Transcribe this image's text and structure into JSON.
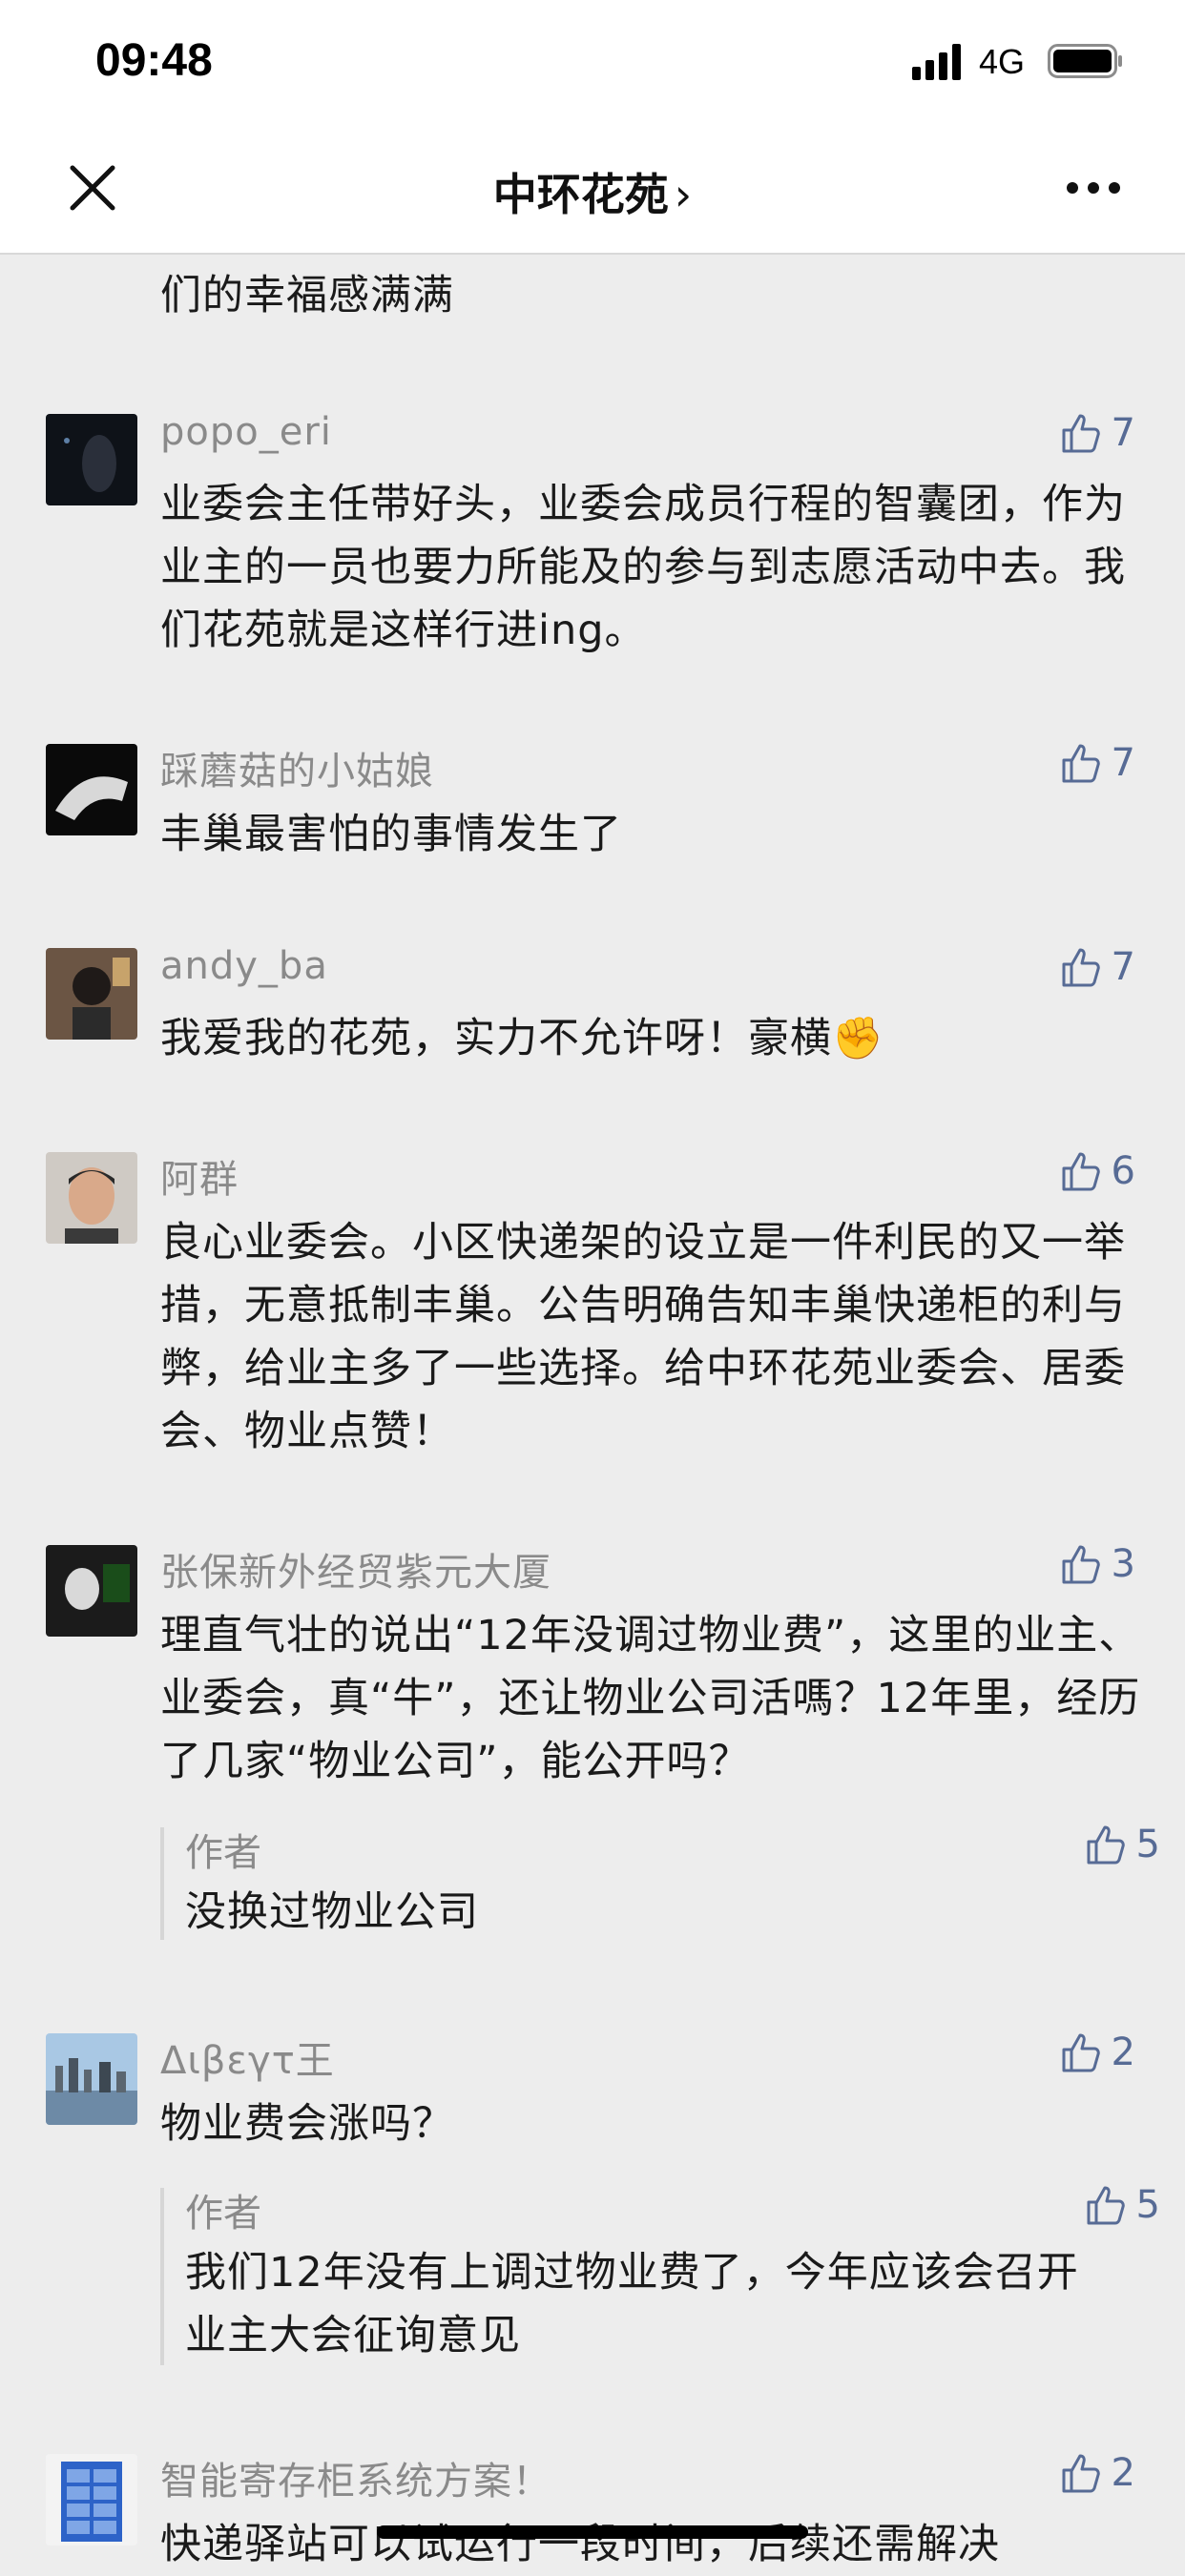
{
  "status_bar": {
    "time": "09:48",
    "network": "4G"
  },
  "nav": {
    "title": "中环花苑",
    "chevron": "›"
  },
  "top_partial_text": "们的幸福感满满",
  "comments": [
    {
      "name": "popo_eri",
      "likes": "7",
      "text": "业委会主任带好头，业委会成员行程的智囊团，作为业主的一员也要力所能及的参与到志愿活动中去。我们花苑就是这样行进ing。"
    },
    {
      "name": "踩蘑菇的小姑娘",
      "likes": "7",
      "text": "丰巢最害怕的事情发生了"
    },
    {
      "name": "andy_ba",
      "likes": "7",
      "text": "我爱我的花苑，实力不允许呀！豪横",
      "emoji": "✊"
    },
    {
      "name": "阿群",
      "likes": "6",
      "text": "良心业委会。小区快递架的设立是一件利民的又一举措，无意抵制丰巢。公告明确告知丰巢快递柜的利与弊，给业主多了一些选择。给中环花苑业委会、居委会、物业点赞！"
    },
    {
      "name": "张保新外经贸紫元大厦",
      "likes": "3",
      "text": "理直气壮的说出“12年没调过物业费”，这里的业主、业委会，真“牛”，还让物业公司活嗎？12年里，经历了几家“物业公司”，能公开吗？",
      "reply": {
        "author": "作者",
        "likes": "5",
        "text": "没换过物业公司"
      }
    },
    {
      "name": "Διβεγτ王",
      "likes": "2",
      "text": "物业费会涨吗？",
      "reply": {
        "author": "作者",
        "likes": "5",
        "text": "我们12年没有上调过物业费了，今年应该会召开业主大会征询意见"
      }
    },
    {
      "name": "智能寄存柜系统方案！",
      "likes": "2",
      "text": "快递驿站可以试运行一段时间，后续还需解决"
    }
  ]
}
